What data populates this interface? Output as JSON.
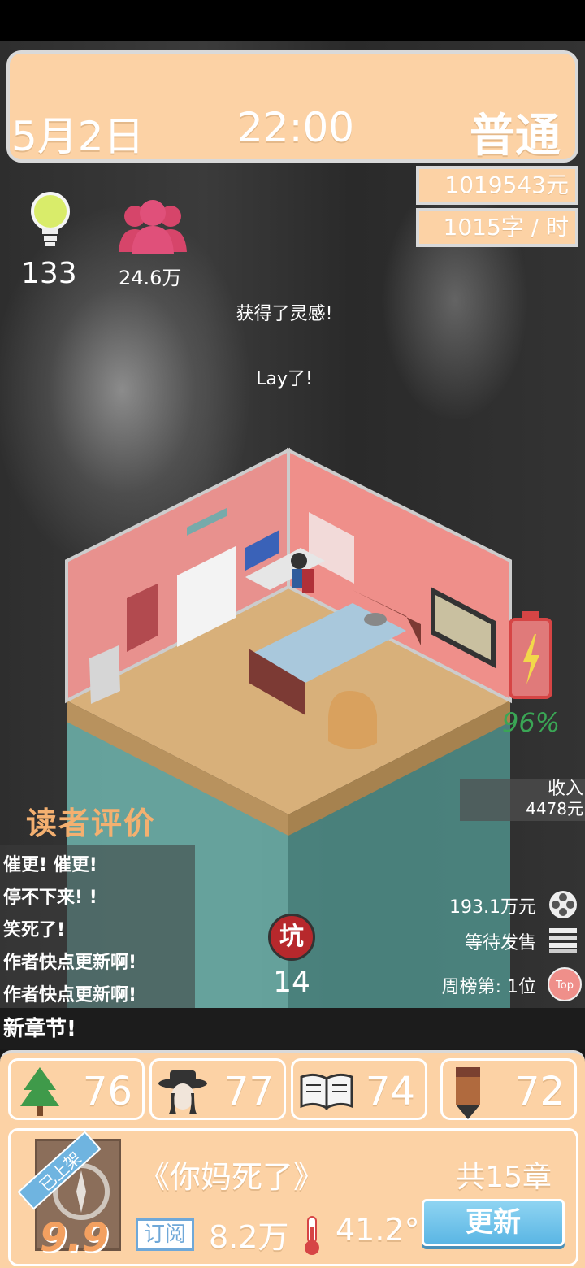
{
  "header": {
    "date": "5月2日",
    "time": "22:00",
    "mode": "普通",
    "money": "1019543元",
    "speed": "1015字 / 时"
  },
  "stats": {
    "inspiration": "133",
    "fans": "24.6万"
  },
  "messages": {
    "inspiration_msg": "获得了灵感!",
    "lay_msg": "Lay了!"
  },
  "battery": {
    "percent_text": "96%",
    "level": 0.96
  },
  "income": {
    "label": "收入",
    "value": "4478元"
  },
  "reviews": {
    "title": "读者评价",
    "items": [
      "催更! 催更!",
      "停不下来! !",
      "笑死了!",
      "作者快点更新啊!",
      "作者快点更新啊!"
    ]
  },
  "pit": {
    "icon_text": "坑",
    "count": "14"
  },
  "right_info": {
    "amount": "193.1万元",
    "sale_status": "等待发售",
    "rank": "周榜第: 1位"
  },
  "new_chapter": "新章节!",
  "attributes": [
    {
      "icon": "tree-icon",
      "value": "76"
    },
    {
      "icon": "detective-icon",
      "value": "77"
    },
    {
      "icon": "book-icon",
      "value": "74"
    },
    {
      "icon": "pencil-icon",
      "value": "72"
    }
  ],
  "book": {
    "status_ribbon": "已上架",
    "rating": "9.9",
    "title": "《你妈死了》",
    "chapters": "共15章",
    "subscribe_label": "订阅",
    "subscribers": "8.2万",
    "temperature": "41.2°",
    "update_button": "更新"
  },
  "colors": {
    "panel": "#fcd2a5",
    "accent_blue": "#6fa8d8",
    "battery_red": "#d64545",
    "battery_green": "#3aa655"
  }
}
